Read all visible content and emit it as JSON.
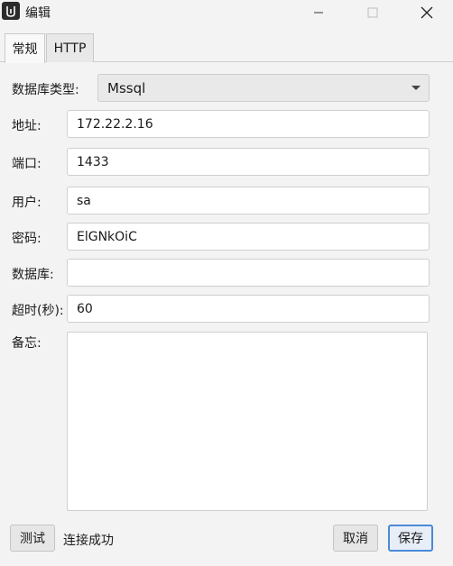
{
  "window": {
    "title": "编辑",
    "app_icon": "app-logo-icon",
    "controls": [
      "minimize-icon",
      "maximize-icon",
      "close-icon"
    ]
  },
  "tabs": [
    {
      "label": "常规",
      "active": true
    },
    {
      "label": "HTTP",
      "active": false
    }
  ],
  "form": {
    "db_type": {
      "label": "数据库类型:",
      "value": "Mssql"
    },
    "address": {
      "label": "地址:",
      "value": "172.22.2.16"
    },
    "port": {
      "label": "端口:",
      "value": "1433"
    },
    "user": {
      "label": "用户:",
      "value": "sa"
    },
    "password": {
      "label": "密码:",
      "value": "ElGNkOiC"
    },
    "database": {
      "label": "数据库:",
      "value": ""
    },
    "timeout": {
      "label": "超时(秒):",
      "value": "60"
    },
    "memo": {
      "label": "备忘:",
      "value": ""
    }
  },
  "footer": {
    "test_label": "测试",
    "status_text": "连接成功",
    "cancel_label": "取消",
    "save_label": "保存"
  },
  "colors": {
    "window_bg": "#f3f3f3",
    "focus_border": "#4a8ad8"
  }
}
